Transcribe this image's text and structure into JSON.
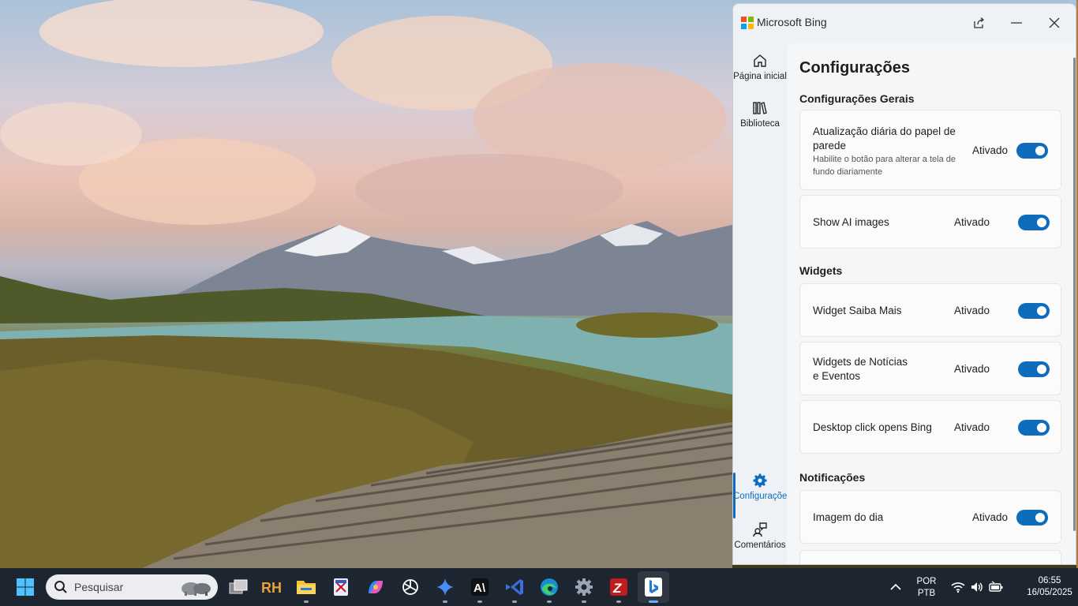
{
  "app": {
    "title": "Microsoft Bing"
  },
  "nav": [
    {
      "label": "Página inicial",
      "icon": "home-icon"
    },
    {
      "label": "Biblioteca",
      "icon": "library-icon"
    },
    {
      "label": "Configurações",
      "icon": "gear-icon",
      "active": true
    },
    {
      "label": "Comentários",
      "icon": "feedback-icon"
    }
  ],
  "settings": {
    "title": "Configurações",
    "general_title": "Configurações Gerais",
    "wallpaper_title": "Atualização diária do papel de parede",
    "wallpaper_desc": "Habilite o botão para alterar a tela de fundo diariamente",
    "wallpaper_state": "Ativado",
    "ai_title": "Show AI images",
    "ai_state": "Ativado",
    "widgets_title": "Widgets",
    "learnmore_title": "Widget Saiba Mais",
    "learnmore_state": "Ativado",
    "news_title_1": "Widgets de Notícias",
    "news_title_2": "e Eventos",
    "news_state": "Ativado",
    "desktop_title": "Desktop click opens Bing",
    "desktop_state": "Ativado",
    "notifications_title": "Notificações",
    "image_day_title": "Imagem do dia",
    "image_day_state": "Ativado"
  },
  "taskbar": {
    "search_placeholder": "Pesquisar",
    "apps": [
      "task-view",
      "rh-app",
      "file-explorer",
      "snipping-tool",
      "copilot",
      "chatgpt",
      "gemini",
      "anthropic",
      "visual-studio",
      "edge",
      "settings",
      "filezilla",
      "bing"
    ],
    "language": "POR",
    "keyboard": "PTB",
    "time": "06:55",
    "date": "16/05/2025"
  },
  "colors": {
    "accent": "#0f6cbd",
    "taskbar": "#1d2530",
    "ms_red": "#f25022",
    "ms_green": "#7fba00",
    "ms_blue": "#00a4ef",
    "ms_yellow": "#ffb900"
  }
}
